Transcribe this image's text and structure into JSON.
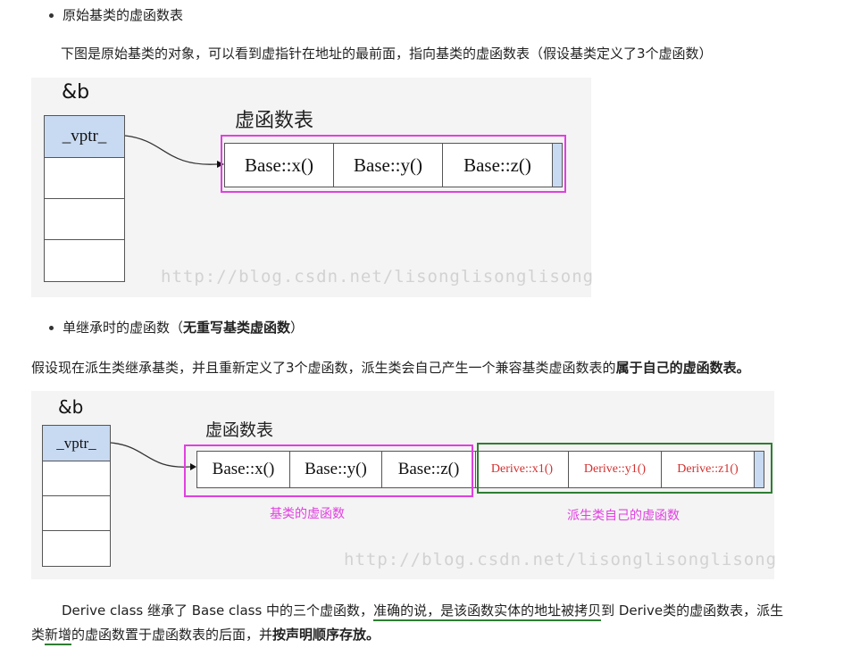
{
  "section1": {
    "bullet": "原始基类的虚函数表",
    "paragraph": "下图是原始基类的对象，可以看到虚指针在地址的最前面，指向基类的虚函数表（假设基类定义了3个虚函数）"
  },
  "figure1": {
    "pointer_label": "&b",
    "vptr_label": "_vptr_",
    "vtable_label": "虚函数表",
    "functions": [
      "Base::x()",
      "Base::y()",
      "Base::z()"
    ],
    "watermark": "http://blog.csdn.net/lisonglisonglisong"
  },
  "section2": {
    "bullet_prefix": "单继承时的虚函数（",
    "bullet_bold": "无重写基类虚函数",
    "bullet_suffix": "）",
    "paragraph_prefix": "假设现在派生类继承基类，并且重新定义了3个虚函数，派生类会自己产生一个兼容基类虚函数表的",
    "paragraph_bold": "属于自己的虚函数表。"
  },
  "figure2": {
    "pointer_label": "&b",
    "vptr_label": "_vptr_",
    "vtable_label": "虚函数表",
    "base_functions": [
      "Base::x()",
      "Base::y()",
      "Base::z()"
    ],
    "derive_functions": [
      "Derive::x1()",
      "Derive::y1()",
      "Derive::z1()"
    ],
    "base_caption": "基类的虚函数",
    "derive_caption": "派生类自己的虚函数",
    "watermark": "http://blog.csdn.net/lisonglisonglisong"
  },
  "section3": {
    "line1_prefix": "Derive class 继承了 Base class 中的三个虚函数，",
    "line1_underlined": "准确的说，是该函数实体的地址被拷贝",
    "line1_suffix": "到 Derive类的虚函数表，派生",
    "line2_prefix": "类",
    "line2_underlined": "新增",
    "line2_middle": "的虚函数置于虚函数表的后面，并",
    "line2_bold": "按声明顺序存放。"
  },
  "colors": {
    "highlight_pink": "#e040e0",
    "highlight_green": "#2e7d32",
    "vptr_fill": "#c8daf2",
    "derive_text": "#d32f2f"
  }
}
